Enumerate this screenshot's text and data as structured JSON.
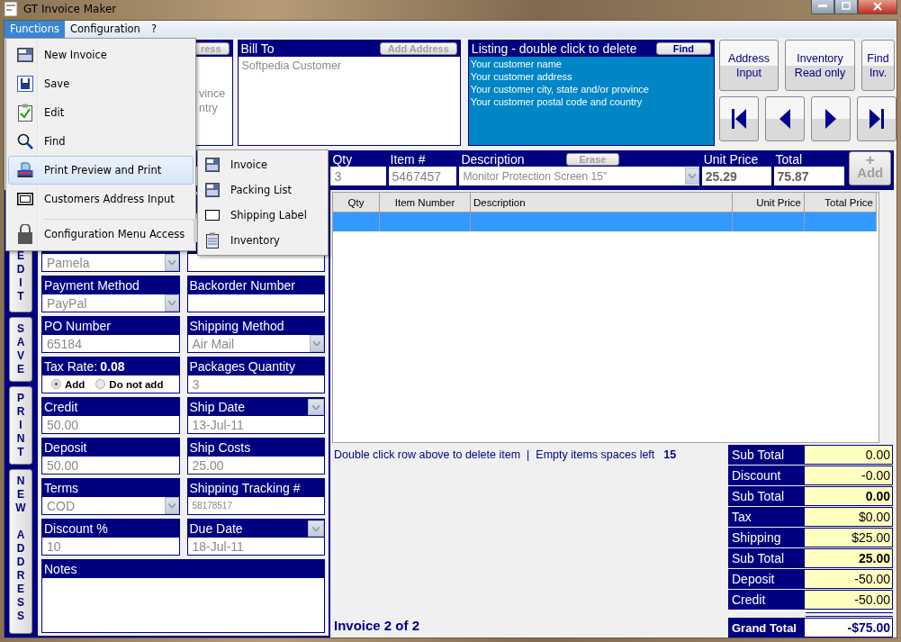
{
  "window": {
    "title": "GT Invoice Maker"
  },
  "menu_bar": [
    {
      "label": "Functions",
      "selected": true
    },
    {
      "label": "Configuration",
      "selected": false
    },
    {
      "label": "?",
      "selected": false
    }
  ],
  "functions_menu": [
    {
      "label": "New Invoice",
      "kind": "invoice",
      "selected": false,
      "separator_before": false
    },
    {
      "label": "Save",
      "kind": "save",
      "selected": false,
      "separator_before": false
    },
    {
      "label": "Edit",
      "kind": "edit",
      "selected": false,
      "separator_before": false
    },
    {
      "label": "Find",
      "kind": "find",
      "selected": false,
      "separator_before": false
    },
    {
      "label": "Print Preview and Print",
      "kind": "print",
      "selected": true,
      "separator_before": false
    },
    {
      "label": "Customers Address Input",
      "kind": "frame",
      "selected": false,
      "separator_before": false
    },
    {
      "label": "Configuration Menu Access",
      "kind": "lock",
      "selected": false,
      "separator_before": true
    }
  ],
  "print_submenu": [
    {
      "label": "Invoice",
      "kind": "invoice"
    },
    {
      "label": "Packing List",
      "kind": "invoice"
    },
    {
      "label": "Shipping Label",
      "kind": "frame"
    },
    {
      "label": "Inventory",
      "kind": "list"
    }
  ],
  "ship_to": {
    "button": "ress",
    "lines": [
      "vince",
      "ntry"
    ]
  },
  "bill_to": {
    "title": "Bill To",
    "button": "Add Address",
    "value": "Softpedia Customer"
  },
  "listing": {
    "title": "Listing - double click to delete",
    "button": "Find",
    "lines": [
      "Your customer name",
      "Your customer address",
      "Your customer city, state and/or province",
      "Your customer postal code and country"
    ]
  },
  "action_buttons": [
    {
      "label": "Address Input"
    },
    {
      "label": "Inventory Read only"
    },
    {
      "label": "Find Inv."
    }
  ],
  "nav_buttons": [
    {
      "kind": "first"
    },
    {
      "kind": "prev"
    },
    {
      "kind": "next"
    },
    {
      "kind": "last"
    }
  ],
  "item_entry": {
    "fields": [
      {
        "label": "Qty",
        "value": "3",
        "kind": "text"
      },
      {
        "label": "Item #",
        "value": "5467457",
        "kind": "text"
      },
      {
        "label": "Description",
        "value": "Monitor Protection Screen 15\"",
        "button": "Erase",
        "kind": "dropdown"
      },
      {
        "label": "Unit Price",
        "value": "25.29",
        "kind": "bold"
      },
      {
        "label": "Total",
        "value": "75.87",
        "kind": "bold"
      }
    ],
    "add_button": {
      "icon": "+",
      "label": "Add"
    }
  },
  "side_buttons": [
    "EDIT",
    "SAVE",
    "PRINT",
    "NEW ADDRESS"
  ],
  "left_fields": [
    {
      "kind": "dropdown",
      "value": "Pamela"
    },
    {
      "kind": "dropdown",
      "label": "Payment Method",
      "value": "PayPal"
    },
    {
      "kind": "text",
      "label": "PO Number",
      "value": "65184"
    },
    {
      "kind": "radio",
      "label": "Tax Rate:",
      "rate": "0.08",
      "options": [
        {
          "label": "Add",
          "selected": true
        },
        {
          "label": "Do not add",
          "selected": false
        }
      ]
    },
    {
      "kind": "text",
      "label": "Credit",
      "value": "50.00"
    },
    {
      "kind": "text",
      "label": "Deposit",
      "value": "50.00"
    },
    {
      "kind": "dropdown",
      "label": "Terms",
      "value": "COD"
    },
    {
      "kind": "text",
      "label": "Discount %",
      "value": "10"
    }
  ],
  "right_fields": [
    {
      "kind": "text"
    },
    {
      "kind": "text"
    },
    {
      "kind": "text",
      "label": "Backorder Number"
    },
    {
      "kind": "dropdown",
      "label": "Shipping Method",
      "value": "Air Mail"
    },
    {
      "kind": "text",
      "label": "Packages Quantity",
      "value": "3"
    },
    {
      "kind": "date",
      "label": "Ship Date",
      "value": "13-Jul-11"
    },
    {
      "kind": "text",
      "label": "Ship Costs",
      "value": "25.00"
    },
    {
      "kind": "small",
      "label": "Shipping Tracking  #",
      "value": "58178517"
    },
    {
      "kind": "date",
      "label": "Due Date",
      "value": "18-Jul-11"
    }
  ],
  "notes": {
    "label": "Notes"
  },
  "table": {
    "columns": [
      "Qty",
      "Item Number",
      "Description",
      "Unit Price",
      "Total Price"
    ],
    "rows": [
      {
        "selected": true
      }
    ]
  },
  "status": {
    "hint": "Double click row above to delete item",
    "separator": "|",
    "spaces_label": "Empty items spaces left",
    "spaces_count": "15"
  },
  "invoice_position": "Invoice 2 of 2",
  "totals": [
    {
      "label": "Sub Total",
      "value": "0.00",
      "bold": false
    },
    {
      "label": "Discount",
      "value": "-0.00",
      "bold": false
    },
    {
      "label": "Sub Total",
      "value": "0.00",
      "bold": true
    },
    {
      "label": "Tax",
      "value": "$0.00",
      "bold": false
    },
    {
      "label": "Shipping",
      "value": "$25.00",
      "bold": false
    },
    {
      "label": "Sub Total",
      "value": "25.00",
      "bold": true
    },
    {
      "label": "Deposit",
      "value": "-50.00",
      "bold": false
    },
    {
      "label": "Credit",
      "value": "-50.00",
      "bold": false
    }
  ],
  "grand_total": {
    "label": "Grand Total",
    "value": "-$75.00"
  }
}
